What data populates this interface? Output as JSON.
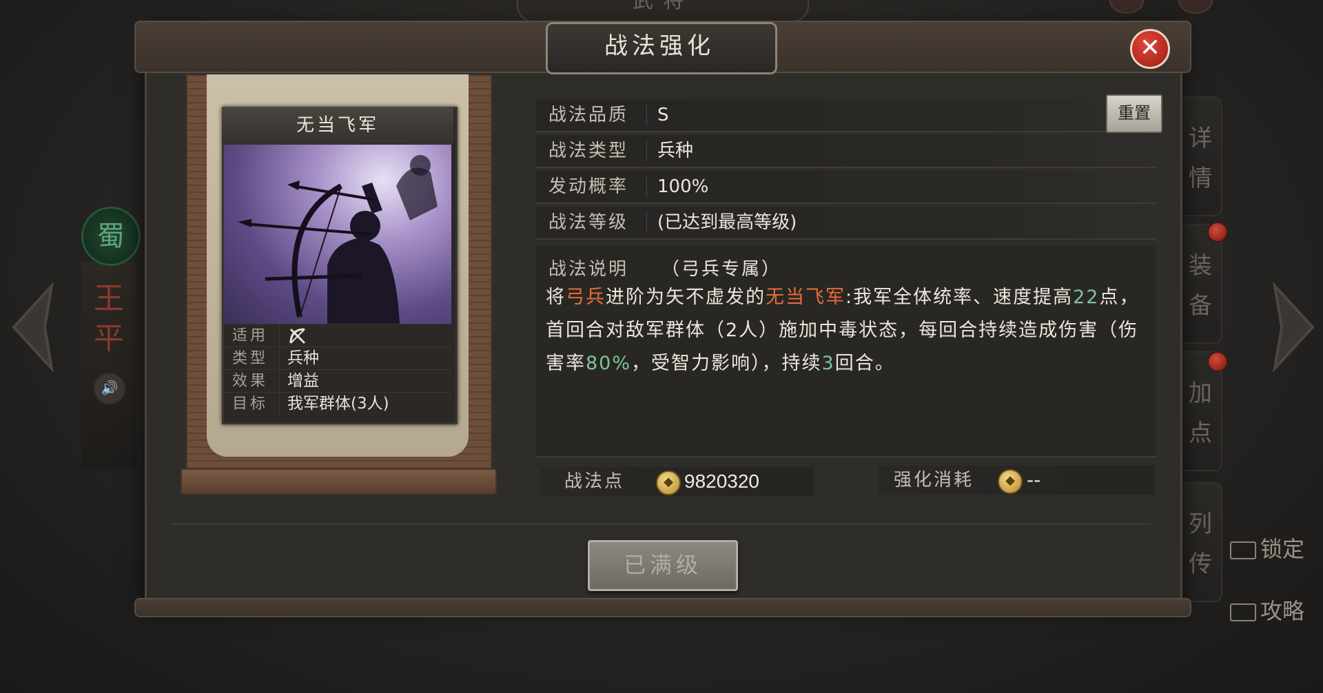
{
  "background": {
    "top_title": "武将",
    "faction": "蜀",
    "general_name": "王平",
    "right_tabs": [
      "详情",
      "装备",
      "加点",
      "列传"
    ],
    "side_links": {
      "lock": "锁定",
      "guide": "攻略"
    }
  },
  "dialog": {
    "title": "战法强化",
    "close_label": "✕"
  },
  "card": {
    "name": "无当飞军",
    "rows": [
      {
        "key": "适用",
        "value": ""
      },
      {
        "key": "类型",
        "value": "兵种"
      },
      {
        "key": "效果",
        "value": "增益"
      },
      {
        "key": "目标",
        "value": "我军群体(3人)"
      }
    ]
  },
  "info": {
    "rows": [
      {
        "key": "战法品质",
        "value": "S"
      },
      {
        "key": "战法类型",
        "value": "兵种"
      },
      {
        "key": "发动概率",
        "value": "100%"
      },
      {
        "key": "战法等级",
        "value": "(已达到最高等级)"
      }
    ],
    "reset_label": "重置",
    "desc_head": "战法说明",
    "desc_sub": "（弓兵专属）",
    "desc_parts": {
      "p1": "将",
      "p2": "弓兵",
      "p3": "进阶为矢不虚发的",
      "p4": "无当飞军",
      "p5": ":我军全体统率、速度提高",
      "p6": "22",
      "p7": "点，首回合对敌军群体（2人）施加中毒状态，每回合持续造成伤害（伤害率",
      "p8": "80%",
      "p9": "，受智力影响），持续",
      "p10": "3",
      "p11": "回合。"
    }
  },
  "points": {
    "label": "战法点",
    "value": "9820320",
    "cost_label": "强化消耗",
    "cost_value": "--"
  },
  "footer": {
    "max_label": "已满级"
  },
  "colors": {
    "highlight_orange": "#e86d3a",
    "highlight_green": "#7cc59a",
    "close_red": "#c92a1f"
  }
}
